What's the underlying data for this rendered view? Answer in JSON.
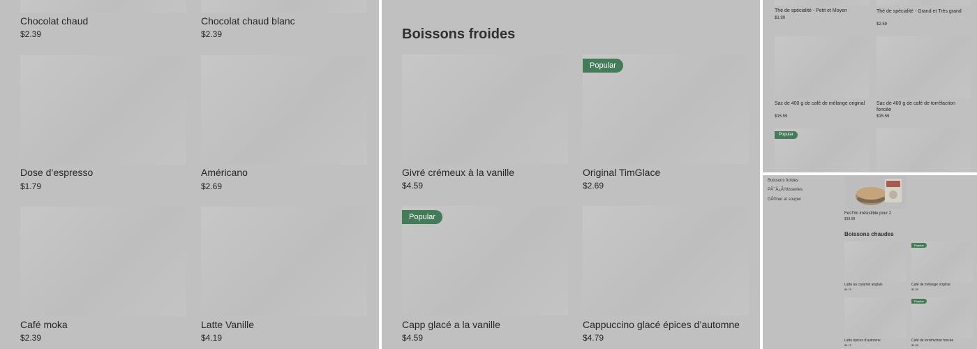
{
  "panel1": {
    "items": [
      {
        "name": "Chocolat chaud",
        "price": "$2.39"
      },
      {
        "name": "Chocolat chaud blanc",
        "price": "$2.39"
      },
      {
        "name": "Dose d’espresso",
        "price": "$1.79"
      },
      {
        "name": "Américano",
        "price": "$2.69"
      },
      {
        "name": "Café moka",
        "price": "$2.39"
      },
      {
        "name": "Latte Vanille",
        "price": "$4.19"
      }
    ]
  },
  "panel2": {
    "heading": "Boissons froides",
    "badge": "Popular",
    "items": [
      {
        "name": "Givré crémeux à la vanille",
        "price": "$4.59"
      },
      {
        "name": "Original TimGlace",
        "price": "$2.69"
      },
      {
        "name": "Capp glacé a la vanille",
        "price": "$4.59"
      },
      {
        "name": "Cappuccino glacé épices d’automne",
        "price": "$4.79"
      }
    ]
  },
  "panel3": {
    "badge": "Popular",
    "items": [
      {
        "name": "Thé de spécialité - Petit et Moyen",
        "price": "$1.99"
      },
      {
        "name": "Thé de spécialité - Grand et Très grand",
        "price": "$2.59"
      },
      {
        "name": "Sac de 400 g de café de mélange original",
        "price": "$15.59"
      },
      {
        "name": "Sac de 400 g de café de torréfaction foncée",
        "price": "$15.59"
      }
    ]
  },
  "panel4": {
    "nav": [
      "Boissons froides",
      "PÃ¯Â¿Â½tisseries",
      "DÃ®ner et souper"
    ],
    "featured": {
      "name": "FesTim irrésistible pour 2",
      "price": "$19.99"
    },
    "heading": "Boissons chaudes",
    "badge": "Popular",
    "items": [
      {
        "name": "Latte au caramel anglais",
        "price": "$4.79"
      },
      {
        "name": "Café de mélange original",
        "price": "$1.99"
      },
      {
        "name": "Latte épices d’automne",
        "price": "$4.79"
      },
      {
        "name": "Café de torréfaction foncée",
        "price": "$1.99"
      }
    ]
  },
  "colors": {
    "overlay": "#c0c0c0",
    "badge": "#437c59",
    "text": "#262626"
  }
}
